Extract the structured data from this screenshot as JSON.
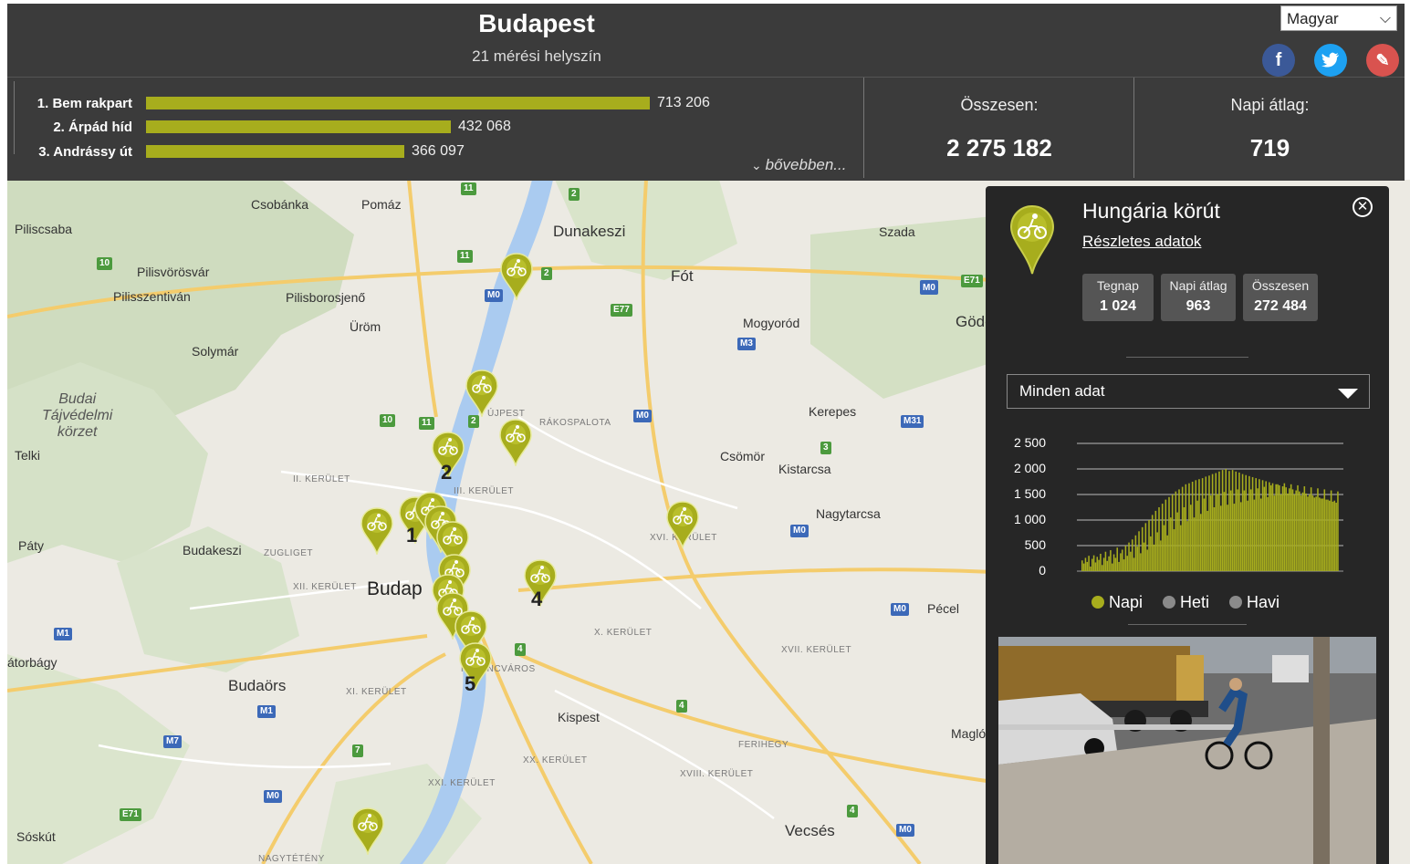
{
  "header": {
    "title": "Budapest",
    "subtitle": "21 mérési helyszín",
    "language": "Magyar",
    "social": [
      {
        "icon": "facebook-icon",
        "glyph": "f",
        "color": "#3b5998"
      },
      {
        "icon": "twitter-icon",
        "glyph": "t",
        "color": "#1da1f2"
      },
      {
        "icon": "link-icon",
        "glyph": "✎",
        "color": "#d9534f"
      }
    ]
  },
  "ranking": {
    "items": [
      {
        "label": "1. Bem rakpart",
        "value": "713 206",
        "amount": 713206
      },
      {
        "label": "2. Árpád híd",
        "value": "432 068",
        "amount": 432068
      },
      {
        "label": "3. Andrássy út",
        "value": "366 097",
        "amount": 366097
      }
    ],
    "more_label": "bővebben..."
  },
  "totals": {
    "total_label": "Összesen:",
    "total_value": "2 275 182",
    "daily_label": "Napi átlag:",
    "daily_value": "719"
  },
  "map": {
    "labels": [
      {
        "t": "Csobánka",
        "c": ""
      },
      {
        "t": "Pomáz",
        "c": ""
      },
      {
        "t": "Dunakeszi",
        "c": "big2"
      },
      {
        "t": "Piliscsaba",
        "c": ""
      },
      {
        "t": "Szada",
        "c": ""
      },
      {
        "t": "Pilisvörösvár",
        "c": ""
      },
      {
        "t": "Fót",
        "c": "big2"
      },
      {
        "t": "Pilisszentiván",
        "c": ""
      },
      {
        "t": "Pilisborosjenő",
        "c": ""
      },
      {
        "t": "Üröm",
        "c": ""
      },
      {
        "t": "Mogyoród",
        "c": ""
      },
      {
        "t": "Gödöllő",
        "c": "big2"
      },
      {
        "t": "Solymár",
        "c": ""
      },
      {
        "t": "ÚJPEST",
        "c": "small"
      },
      {
        "t": "RÁKOSPALOTA",
        "c": "small"
      },
      {
        "t": "Kerepes",
        "c": ""
      },
      {
        "t": "Telki",
        "c": ""
      },
      {
        "t": "II. KERÜLET",
        "c": "small"
      },
      {
        "t": "III. KERÜLET",
        "c": "small"
      },
      {
        "t": "Csömör",
        "c": ""
      },
      {
        "t": "Kistarcsa",
        "c": ""
      },
      {
        "t": "Nagytarcsa",
        "c": ""
      },
      {
        "t": "Páty",
        "c": ""
      },
      {
        "t": "Budakeszi",
        "c": ""
      },
      {
        "t": "ZUGLIGET",
        "c": "small"
      },
      {
        "t": "XVI. KERÜLET",
        "c": "small"
      },
      {
        "t": "XII. KERÜLET",
        "c": "small"
      },
      {
        "t": "Budap",
        "c": "big"
      },
      {
        "t": "Pécel",
        "c": ""
      },
      {
        "t": "X. KERÜLET",
        "c": "small"
      },
      {
        "t": "XVII. KERÜLET",
        "c": "small"
      },
      {
        "t": "átorbágy",
        "c": ""
      },
      {
        "t": "FERENCVÁROS",
        "c": "small"
      },
      {
        "t": "Budaörs",
        "c": "big2"
      },
      {
        "t": "XI. KERÜLET",
        "c": "small"
      },
      {
        "t": "Kispest",
        "c": ""
      },
      {
        "t": "Maglód",
        "c": ""
      },
      {
        "t": "FERIHEGY",
        "c": "small"
      },
      {
        "t": "XX. KERÜLET",
        "c": "small"
      },
      {
        "t": "XVIII. KERÜLET",
        "c": "small"
      },
      {
        "t": "XXI. KERÜLET",
        "c": "small"
      },
      {
        "t": "Vecsés",
        "c": "big2"
      },
      {
        "t": "Sóskút",
        "c": ""
      },
      {
        "t": "NAGYTÉTÉNY",
        "c": "small"
      }
    ],
    "park_label": [
      "Budai",
      "Tájvédelmi",
      "körzet"
    ],
    "cluster_numbers": [
      "1",
      "2",
      "4",
      "5"
    ],
    "shields": [
      "11",
      "2",
      "10",
      "11",
      "2",
      "M0",
      "E77",
      "M3",
      "E71",
      "M3",
      "M0",
      "10",
      "11",
      "2",
      "M0",
      "M31",
      "3",
      "M0",
      "M0",
      "M1",
      "4",
      "M1",
      "M7",
      "4",
      "7",
      "E71",
      "M0",
      "4",
      "M0"
    ]
  },
  "panel": {
    "title": "Hungária körút",
    "details_link": "Részletes adatok",
    "stats": [
      {
        "label": "Tegnap",
        "value": "1 024"
      },
      {
        "label": "Napi átlag",
        "value": "963"
      },
      {
        "label": "Összesen",
        "value": "272 484"
      }
    ],
    "filter": "Minden adat",
    "legend": [
      {
        "label": "Napi",
        "color": "#a7ad1d",
        "active": true
      },
      {
        "label": "Heti",
        "color": "#8a8a8a",
        "active": false
      },
      {
        "label": "Havi",
        "color": "#8a8a8a",
        "active": false
      }
    ]
  },
  "chart_data": {
    "type": "bar",
    "title": "",
    "xlabel": "",
    "ylabel": "",
    "ylim": [
      0,
      2500
    ],
    "y_ticks": [
      "2 500",
      "2 000",
      "1 500",
      "1 000",
      "500",
      "0"
    ],
    "series": [
      {
        "name": "Napi",
        "color": "#a7ad1d",
        "values": [
          210,
          150,
          260,
          180,
          300,
          90,
          240,
          310,
          170,
          280,
          220,
          340,
          120,
          260,
          380,
          200,
          290,
          410,
          150,
          330,
          260,
          460,
          180,
          350,
          420,
          230,
          500,
          300,
          560,
          380,
          620,
          260,
          700,
          480,
          780,
          350,
          860,
          560,
          940,
          420,
          1000,
          680,
          1100,
          520,
          1180,
          760,
          1250,
          600,
          1320,
          900,
          1400,
          700,
          1450,
          1050,
          1500,
          820,
          1560,
          1150,
          1600,
          900,
          1650,
          1250,
          1700,
          980,
          1720,
          1300,
          1750,
          1050,
          1780,
          1380,
          1800,
          1120,
          1820,
          1420,
          1850,
          1180,
          1870,
          1480,
          1900,
          1250,
          1920,
          1500,
          1950,
          1280,
          1980,
          1550,
          2000,
          1300,
          1960,
          1580,
          1980,
          1320,
          1950,
          1600,
          1930,
          1350,
          1900,
          1580,
          1880,
          1380,
          1860,
          1600,
          1840,
          1400,
          1820,
          1620,
          1800,
          1420,
          1780,
          1650,
          1760,
          1450,
          1740,
          1680,
          1720,
          1480,
          1700,
          1700,
          1680,
          1500,
          1660,
          1720,
          1640,
          1520,
          1620,
          1700,
          1600,
          1500,
          1580,
          1680,
          1560,
          1480,
          1540,
          1660,
          1520,
          1460,
          1500,
          1640,
          1480,
          1440,
          1460,
          1620,
          1440,
          1420,
          1420,
          1600,
          1400,
          1400,
          1380,
          1580,
          1360,
          1380,
          1340,
          1560
        ]
      }
    ]
  }
}
